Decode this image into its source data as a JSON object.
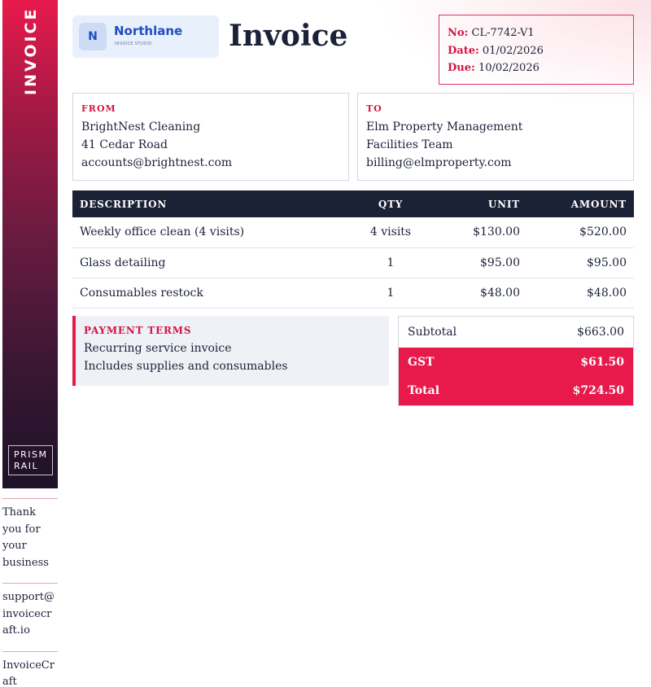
{
  "rail": {
    "title": "INVOICE",
    "brand_line1": "PRISM",
    "brand_line2": "RAIL"
  },
  "side_notes": [
    "Thank you for your business",
    "support@invoicecraft.io",
    "InvoiceCraft"
  ],
  "logo": {
    "initial": "N",
    "name": "Northlane",
    "tagline": "INVOICE STUDIO"
  },
  "title": "Invoice",
  "meta": {
    "number_label": "No:",
    "number": "CL-7742-V1",
    "date_label": "Date:",
    "date": "01/02/2026",
    "due_label": "Due:",
    "due": "10/02/2026"
  },
  "from": {
    "label": "FROM",
    "lines": [
      "BrightNest Cleaning",
      "41 Cedar Road",
      "accounts@brightnest.com"
    ]
  },
  "to": {
    "label": "TO",
    "lines": [
      "Elm Property Management",
      "Facilities Team",
      "billing@elmproperty.com"
    ]
  },
  "items": {
    "headers": {
      "description": "DESCRIPTION",
      "qty": "QTY",
      "unit": "UNIT",
      "amount": "AMOUNT"
    },
    "rows": [
      {
        "description": "Weekly office clean (4 visits)",
        "qty": "4 visits",
        "unit": "$130.00",
        "amount": "$520.00"
      },
      {
        "description": "Glass detailing",
        "qty": "1",
        "unit": "$95.00",
        "amount": "$95.00"
      },
      {
        "description": "Consumables restock",
        "qty": "1",
        "unit": "$48.00",
        "amount": "$48.00"
      }
    ]
  },
  "terms": {
    "label": "PAYMENT TERMS",
    "lines": [
      "Recurring service invoice",
      "Includes supplies and consumables"
    ]
  },
  "totals": {
    "subtotal_label": "Subtotal",
    "subtotal": "$663.00",
    "tax_label": "GST",
    "tax": "$61.50",
    "total_label": "Total",
    "total": "$724.50"
  },
  "colors": {
    "accent": "#e81a4c",
    "dark": "#1b2236",
    "brand_blue": "#1f4fbf"
  }
}
